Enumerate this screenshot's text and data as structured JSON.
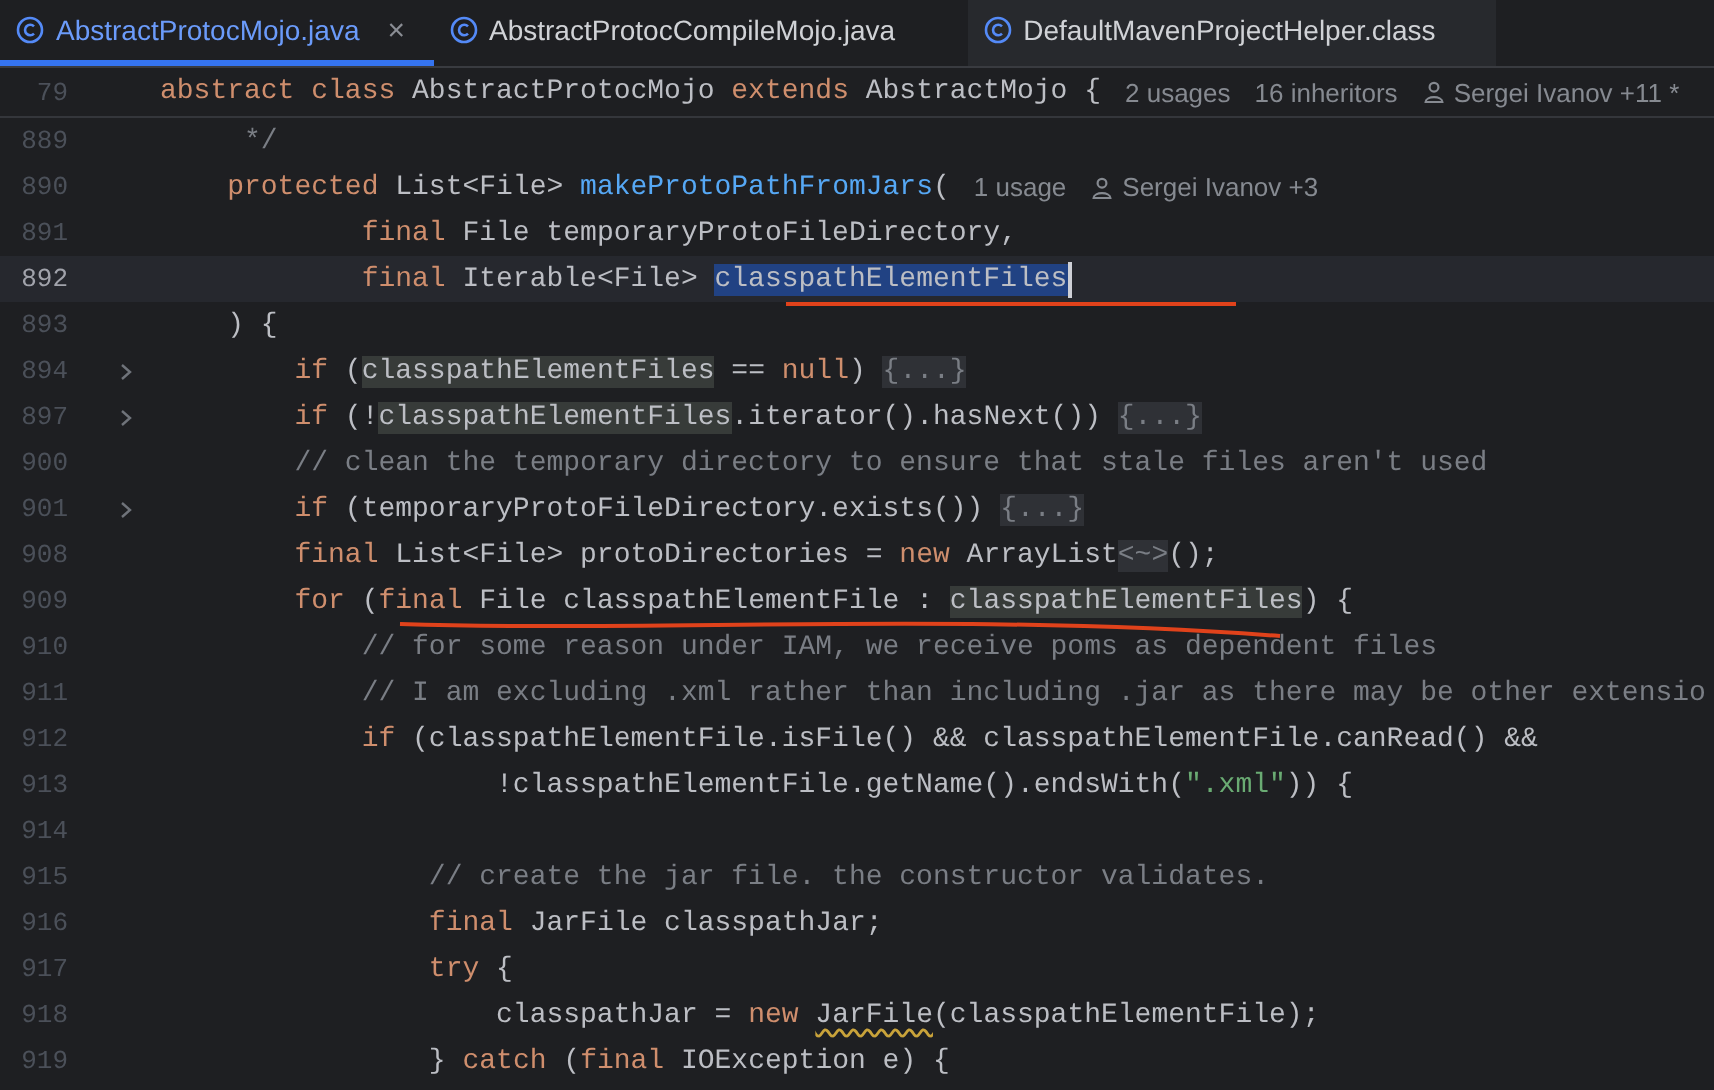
{
  "tabs": [
    {
      "label": "AbstractProtocMojo.java",
      "selected": true,
      "close": "×"
    },
    {
      "label": "AbstractProtocCompileMojo.java",
      "selected": false
    },
    {
      "label": "DefaultMavenProjectHelper.class",
      "selected": false
    }
  ],
  "sticky_line": {
    "number": "79",
    "tokens": [
      {
        "kind": "kw",
        "text": "abstract class"
      },
      {
        "kind": "plain",
        "text": " AbstractProtocMojo "
      },
      {
        "kind": "kw",
        "text": "extends"
      },
      {
        "kind": "plain",
        "text": " AbstractMojo {"
      }
    ],
    "hints": [
      {
        "kind": "usages",
        "text": "2 usages"
      },
      {
        "kind": "usages",
        "text": "16 inheritors"
      },
      {
        "kind": "author",
        "text": "Sergei Ivanov +11 *"
      }
    ]
  },
  "lines": [
    {
      "number": "889",
      "current": false,
      "folded": false,
      "tokens": [
        {
          "kind": "comment",
          "text": "     */"
        }
      ]
    },
    {
      "number": "890",
      "current": false,
      "folded": false,
      "tokens": [
        {
          "kind": "kw",
          "text": "    protected"
        },
        {
          "kind": "plain",
          "text": " List<File> "
        },
        {
          "kind": "method",
          "text": "makeProtoPathFromJars"
        },
        {
          "kind": "plain",
          "text": "("
        }
      ],
      "hints": [
        {
          "kind": "usages",
          "text": "1 usage"
        },
        {
          "kind": "author",
          "text": "Sergei Ivanov +3"
        }
      ]
    },
    {
      "number": "891",
      "current": false,
      "folded": false,
      "tokens": [
        {
          "kind": "kw",
          "text": "            final"
        },
        {
          "kind": "plain",
          "text": " File temporaryProtoFileDirectory,"
        }
      ]
    },
    {
      "number": "892",
      "current": true,
      "folded": false,
      "tokens": [
        {
          "kind": "kw",
          "text": "            final"
        },
        {
          "kind": "plain",
          "text": " Iterable<File> "
        },
        {
          "kind": "selected",
          "text": "classpathElementFiles"
        }
      ]
    },
    {
      "number": "893",
      "current": false,
      "folded": false,
      "tokens": [
        {
          "kind": "plain",
          "text": "    ) {"
        }
      ]
    },
    {
      "number": "894",
      "current": false,
      "folded": true,
      "tokens": [
        {
          "kind": "kw",
          "text": "        if"
        },
        {
          "kind": "plain",
          "text": " ("
        },
        {
          "kind": "usage",
          "text": "classpathElementFiles"
        },
        {
          "kind": "plain",
          "text": " == "
        },
        {
          "kind": "kw",
          "text": "null"
        },
        {
          "kind": "plain",
          "text": ") "
        },
        {
          "kind": "fold",
          "text": "{...}"
        }
      ]
    },
    {
      "number": "897",
      "current": false,
      "folded": true,
      "tokens": [
        {
          "kind": "kw",
          "text": "        if"
        },
        {
          "kind": "plain",
          "text": " (!"
        },
        {
          "kind": "usage",
          "text": "classpathElementFiles"
        },
        {
          "kind": "plain",
          "text": ".iterator().hasNext()) "
        },
        {
          "kind": "fold",
          "text": "{...}"
        }
      ]
    },
    {
      "number": "900",
      "current": false,
      "folded": false,
      "tokens": [
        {
          "kind": "comment",
          "text": "        // clean the temporary directory to ensure that stale files aren't used"
        }
      ]
    },
    {
      "number": "901",
      "current": false,
      "folded": true,
      "tokens": [
        {
          "kind": "kw",
          "text": "        if"
        },
        {
          "kind": "plain",
          "text": " (temporaryProtoFileDirectory.exists()) "
        },
        {
          "kind": "fold",
          "text": "{...}"
        }
      ]
    },
    {
      "number": "908",
      "current": false,
      "folded": false,
      "tokens": [
        {
          "kind": "kw",
          "text": "        final"
        },
        {
          "kind": "plain",
          "text": " List<File> protoDirectories = "
        },
        {
          "kind": "kw",
          "text": "new"
        },
        {
          "kind": "plain",
          "text": " ArrayList"
        },
        {
          "kind": "fold",
          "text": "<~>"
        },
        {
          "kind": "plain",
          "text": "();"
        }
      ]
    },
    {
      "number": "909",
      "current": false,
      "folded": false,
      "tokens": [
        {
          "kind": "kw",
          "text": "        for"
        },
        {
          "kind": "plain",
          "text": " ("
        },
        {
          "kind": "kw",
          "text": "final"
        },
        {
          "kind": "plain",
          "text": " File classpathElementFile : "
        },
        {
          "kind": "usage",
          "text": "classpathElementFiles"
        },
        {
          "kind": "plain",
          "text": ") {"
        }
      ]
    },
    {
      "number": "910",
      "current": false,
      "folded": false,
      "tokens": [
        {
          "kind": "comment",
          "text": "            // for some reason under IAM, we receive poms as dependent files"
        }
      ]
    },
    {
      "number": "911",
      "current": false,
      "folded": false,
      "tokens": [
        {
          "kind": "comment",
          "text": "            // I am excluding .xml rather than including .jar as there may be other extensio"
        }
      ]
    },
    {
      "number": "912",
      "current": false,
      "folded": false,
      "tokens": [
        {
          "kind": "kw",
          "text": "            if"
        },
        {
          "kind": "plain",
          "text": " (classpathElementFile.isFile() && classpathElementFile.canRead() &&"
        }
      ]
    },
    {
      "number": "913",
      "current": false,
      "folded": false,
      "tokens": [
        {
          "kind": "plain",
          "text": "                    !classpathElementFile.getName().endsWith("
        },
        {
          "kind": "string",
          "text": "\".xml\""
        },
        {
          "kind": "plain",
          "text": ")) {"
        }
      ]
    },
    {
      "number": "914",
      "current": false,
      "folded": false
    },
    {
      "number": "915",
      "current": false,
      "folded": false,
      "tokens": [
        {
          "kind": "comment",
          "text": "                // create the jar file. the constructor validates."
        }
      ]
    },
    {
      "number": "916",
      "current": false,
      "folded": false,
      "tokens": [
        {
          "kind": "kw",
          "text": "                final"
        },
        {
          "kind": "plain",
          "text": " JarFile classpathJar;"
        }
      ]
    },
    {
      "number": "917",
      "current": false,
      "folded": false,
      "tokens": [
        {
          "kind": "kw",
          "text": "                try"
        },
        {
          "kind": "plain",
          "text": " {"
        }
      ]
    },
    {
      "number": "918",
      "current": false,
      "folded": false,
      "tokens": [
        {
          "kind": "plain",
          "text": "                    classpathJar = "
        },
        {
          "kind": "kw",
          "text": "new "
        },
        {
          "kind": "warn",
          "text": "JarFile"
        },
        {
          "kind": "plain",
          "text": "(classpathElementFile);"
        }
      ]
    },
    {
      "number": "919",
      "current": false,
      "folded": false,
      "tokens": [
        {
          "kind": "plain",
          "text": "                } "
        },
        {
          "kind": "kw",
          "text": "catch"
        },
        {
          "kind": "plain",
          "text": " ("
        },
        {
          "kind": "kw",
          "text": "final"
        },
        {
          "kind": "plain",
          "text": " IOException e) {"
        }
      ]
    }
  ]
}
